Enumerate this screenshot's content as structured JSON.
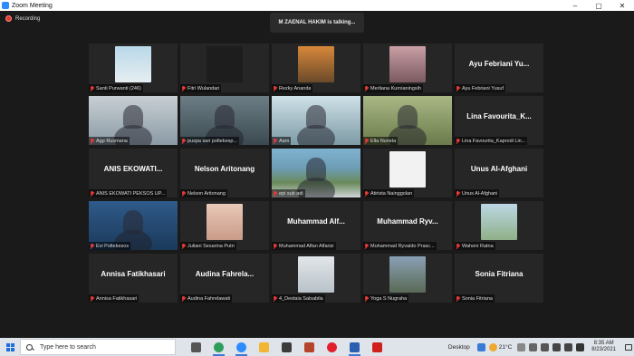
{
  "window": {
    "title": "Zoom Meeting",
    "controls": [
      "–",
      "▢",
      "✕"
    ]
  },
  "meeting": {
    "recording_label": "Recording",
    "talking_banner": "M ZAENAL HAKIM is talking..."
  },
  "participants": [
    {
      "name": "Santi Purwanti (246)",
      "display": "",
      "video": "bg-sky",
      "avatar": true
    },
    {
      "name": "Fitri Wulandari",
      "display": "",
      "video": "bg-dark",
      "avatar": true
    },
    {
      "name": "Rezky Ananda",
      "display": "",
      "video": "bg-orange",
      "avatar": true
    },
    {
      "name": "Merliana Kurnianingsih",
      "display": "",
      "video": "bg-pink",
      "avatar": true
    },
    {
      "name": "Ayu Febriani Yusuf",
      "display": "Ayu Febriani Yu...",
      "video": "",
      "avatar": false
    },
    {
      "name": "Agp Rusmana",
      "display": "",
      "video": "bg-room",
      "avatar": false
    },
    {
      "name": "puspa sari poltekesp...",
      "display": "",
      "video": "bg-office",
      "avatar": false
    },
    {
      "name": "Aam",
      "display": "",
      "video": "bg-window",
      "avatar": false
    },
    {
      "name": "Ella Nuriela",
      "display": "",
      "video": "bg-green",
      "avatar": false
    },
    {
      "name": "Lina Favourita_Kaprodi Lin...",
      "display": "Lina Favourita_K...",
      "video": "",
      "avatar": false
    },
    {
      "name": "ANIS EKOWATI PEKSOS UP...",
      "display": "ANIS EKOWATI...",
      "video": "",
      "avatar": false
    },
    {
      "name": "Nelson Aritonang",
      "display": "Nelson Aritonang",
      "video": "",
      "avatar": false
    },
    {
      "name": "epi sub adi",
      "display": "",
      "video": "bg-outdoor",
      "avatar": false
    },
    {
      "name": "Atirista Nainggolan",
      "display": "",
      "video": "bg-logo",
      "avatar": true
    },
    {
      "name": "Unus Al-Afghani",
      "display": "Unus Al-Afghani",
      "video": "",
      "avatar": false
    },
    {
      "name": "Evi Poltekesos",
      "display": "",
      "video": "bg-blue",
      "avatar": false
    },
    {
      "name": "Juliani Sesarina Putri",
      "display": "",
      "video": "bg-peach",
      "avatar": true
    },
    {
      "name": "Muhammad Alfan Alfarizi",
      "display": "Muhammad Alf...",
      "video": "",
      "avatar": false
    },
    {
      "name": "Muhammad Ryvaldo Prasc...",
      "display": "Muhammad Ryv...",
      "video": "",
      "avatar": false
    },
    {
      "name": "Waheni Ratna",
      "display": "",
      "video": "bg-field",
      "avatar": true
    },
    {
      "name": "Annisa Fatikhasari",
      "display": "Annisa Fatikhasari",
      "video": "",
      "avatar": false
    },
    {
      "name": "Audina Fahrelawati",
      "display": "Audina Fahrela...",
      "video": "",
      "avatar": false
    },
    {
      "name": "4_Destaia Salsabila",
      "display": "",
      "video": "bg-light",
      "avatar": true
    },
    {
      "name": "Yoga S Nugraha",
      "display": "",
      "video": "bg-mountain",
      "avatar": true
    },
    {
      "name": "Sonia Fitriana",
      "display": "Sonia Fitriana",
      "video": "",
      "avatar": false
    }
  ],
  "taskbar": {
    "search_placeholder": "Type here to search",
    "desktop_label": "Desktop",
    "temperature": "21°C",
    "time": "8:35 AM",
    "date": "8/23/2021",
    "apps": [
      {
        "name": "task-view",
        "color": "#555555"
      },
      {
        "name": "chrome",
        "color": "#2f9e5a"
      },
      {
        "name": "zoom",
        "color": "#2d8cff"
      },
      {
        "name": "file-explorer",
        "color": "#f2b632"
      },
      {
        "name": "store",
        "color": "#3b3b3b"
      },
      {
        "name": "garuda",
        "color": "#b5442c"
      },
      {
        "name": "opera",
        "color": "#e2202c"
      },
      {
        "name": "word",
        "color": "#2b5faf"
      },
      {
        "name": "acrobat",
        "color": "#d0201b"
      }
    ]
  }
}
